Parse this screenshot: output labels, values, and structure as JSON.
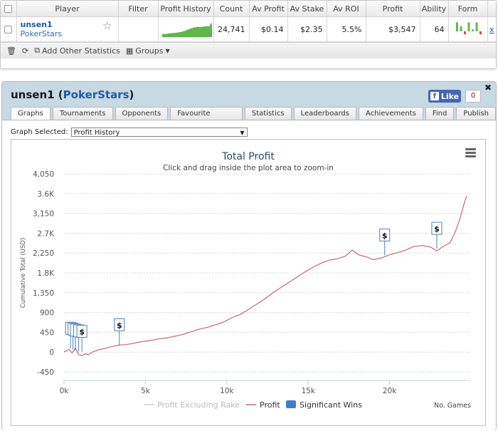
{
  "table": {
    "headers": [
      "Player",
      "Filter",
      "Profit History",
      "Count",
      "Av Profit",
      "Av Stake",
      "Av ROI",
      "Profit",
      "Ability",
      "Form"
    ],
    "row": {
      "player": "unsen1",
      "site": "PokerStars",
      "count": "24,741",
      "av_profit": "$0.14",
      "av_stake": "$2.35",
      "av_roi": "5.5%",
      "profit": "$3,547",
      "ability": "64",
      "remove": "x"
    },
    "form_bars": [
      {
        "value": 0.9,
        "color": "#5fb84a"
      },
      {
        "value": 0.5,
        "color": "#5fb84a"
      },
      {
        "value": -0.3,
        "color": "#d05050"
      },
      {
        "value": 0.9,
        "color": "#5fb84a"
      },
      {
        "value": 0.2,
        "color": "#5fb84a"
      },
      {
        "value": 0.9,
        "color": "#5fb84a"
      },
      {
        "value": -0.3,
        "color": "#d05050"
      }
    ]
  },
  "toolbar": {
    "add_label": "Add Other Statistics",
    "groups_label": "Groups"
  },
  "panel": {
    "title_player": "unsen1",
    "title_site": "PokerStars",
    "fb_like": "Like",
    "fb_count": "0",
    "tabs": [
      "Graphs",
      "Tournaments",
      "Opponents",
      "Favourite Games",
      "Statistics",
      "Leaderboards",
      "Achievements",
      "Find",
      "Publish"
    ],
    "active_tab": "Graphs",
    "graph_selected_label": "Graph Selected:",
    "graph_selected_value": "Profit History"
  },
  "chart_data": {
    "type": "line",
    "title": "Total Profit",
    "subtitle": "Click and drag inside the plot area to zoom-in",
    "ylabel": "Cumulative Total (USD)",
    "xlabel": "No. Games",
    "yticks": [
      "-450",
      "0",
      "450",
      "900",
      "1,350",
      "1.8K",
      "2,250",
      "2.7K",
      "3,150",
      "3.6K",
      "4,050"
    ],
    "ytick_values": [
      -450,
      0,
      450,
      900,
      1350,
      1800,
      2250,
      2700,
      3150,
      3600,
      4050
    ],
    "xticks": [
      "0k",
      "5k",
      "10k",
      "15k",
      "20k"
    ],
    "xtick_values": [
      0,
      5000,
      10000,
      15000,
      20000
    ],
    "xlim": [
      0,
      25000
    ],
    "ylim": [
      -450,
      4050
    ],
    "series": [
      {
        "name": "Profit Excluding Rake",
        "color": "#cccccc",
        "points": []
      },
      {
        "name": "Profit",
        "color": "#c26a6a",
        "points": [
          [
            0,
            0
          ],
          [
            300,
            60
          ],
          [
            500,
            -20
          ],
          [
            700,
            90
          ],
          [
            900,
            -60
          ],
          [
            1100,
            -80
          ],
          [
            1300,
            -40
          ],
          [
            1500,
            -60
          ],
          [
            1800,
            10
          ],
          [
            2200,
            60
          ],
          [
            2600,
            90
          ],
          [
            3000,
            130
          ],
          [
            3400,
            160
          ],
          [
            3800,
            170
          ],
          [
            4300,
            200
          ],
          [
            4800,
            240
          ],
          [
            5300,
            260
          ],
          [
            5800,
            300
          ],
          [
            6300,
            320
          ],
          [
            6800,
            360
          ],
          [
            7300,
            400
          ],
          [
            7800,
            460
          ],
          [
            8300,
            520
          ],
          [
            8800,
            560
          ],
          [
            9300,
            620
          ],
          [
            9800,
            680
          ],
          [
            10300,
            780
          ],
          [
            10800,
            850
          ],
          [
            11300,
            960
          ],
          [
            11800,
            1080
          ],
          [
            12300,
            1200
          ],
          [
            12800,
            1340
          ],
          [
            13300,
            1460
          ],
          [
            13800,
            1580
          ],
          [
            14300,
            1700
          ],
          [
            14800,
            1820
          ],
          [
            15300,
            1930
          ],
          [
            15800,
            2020
          ],
          [
            16300,
            2090
          ],
          [
            16800,
            2120
          ],
          [
            17300,
            2180
          ],
          [
            17700,
            2320
          ],
          [
            18100,
            2210
          ],
          [
            18600,
            2160
          ],
          [
            19000,
            2100
          ],
          [
            19500,
            2140
          ],
          [
            20000,
            2210
          ],
          [
            20500,
            2260
          ],
          [
            21000,
            2320
          ],
          [
            21500,
            2400
          ],
          [
            22000,
            2420
          ],
          [
            22500,
            2390
          ],
          [
            22900,
            2300
          ],
          [
            23300,
            2400
          ],
          [
            23700,
            2480
          ],
          [
            24000,
            2700
          ],
          [
            24300,
            3000
          ],
          [
            24600,
            3400
          ],
          [
            24741,
            3547
          ]
        ]
      }
    ],
    "significant_wins_label": "Significant Wins",
    "significant_wins": [
      {
        "x": 400,
        "y": 80
      },
      {
        "x": 550,
        "y": 60
      },
      {
        "x": 700,
        "y": 40
      },
      {
        "x": 900,
        "y": 20
      },
      {
        "x": 1100,
        "y": 10
      },
      {
        "x": 3400,
        "y": 160
      },
      {
        "x": 19700,
        "y": 2200
      },
      {
        "x": 22900,
        "y": 2350
      }
    ],
    "legend_placement": "bottom",
    "grid": true
  }
}
